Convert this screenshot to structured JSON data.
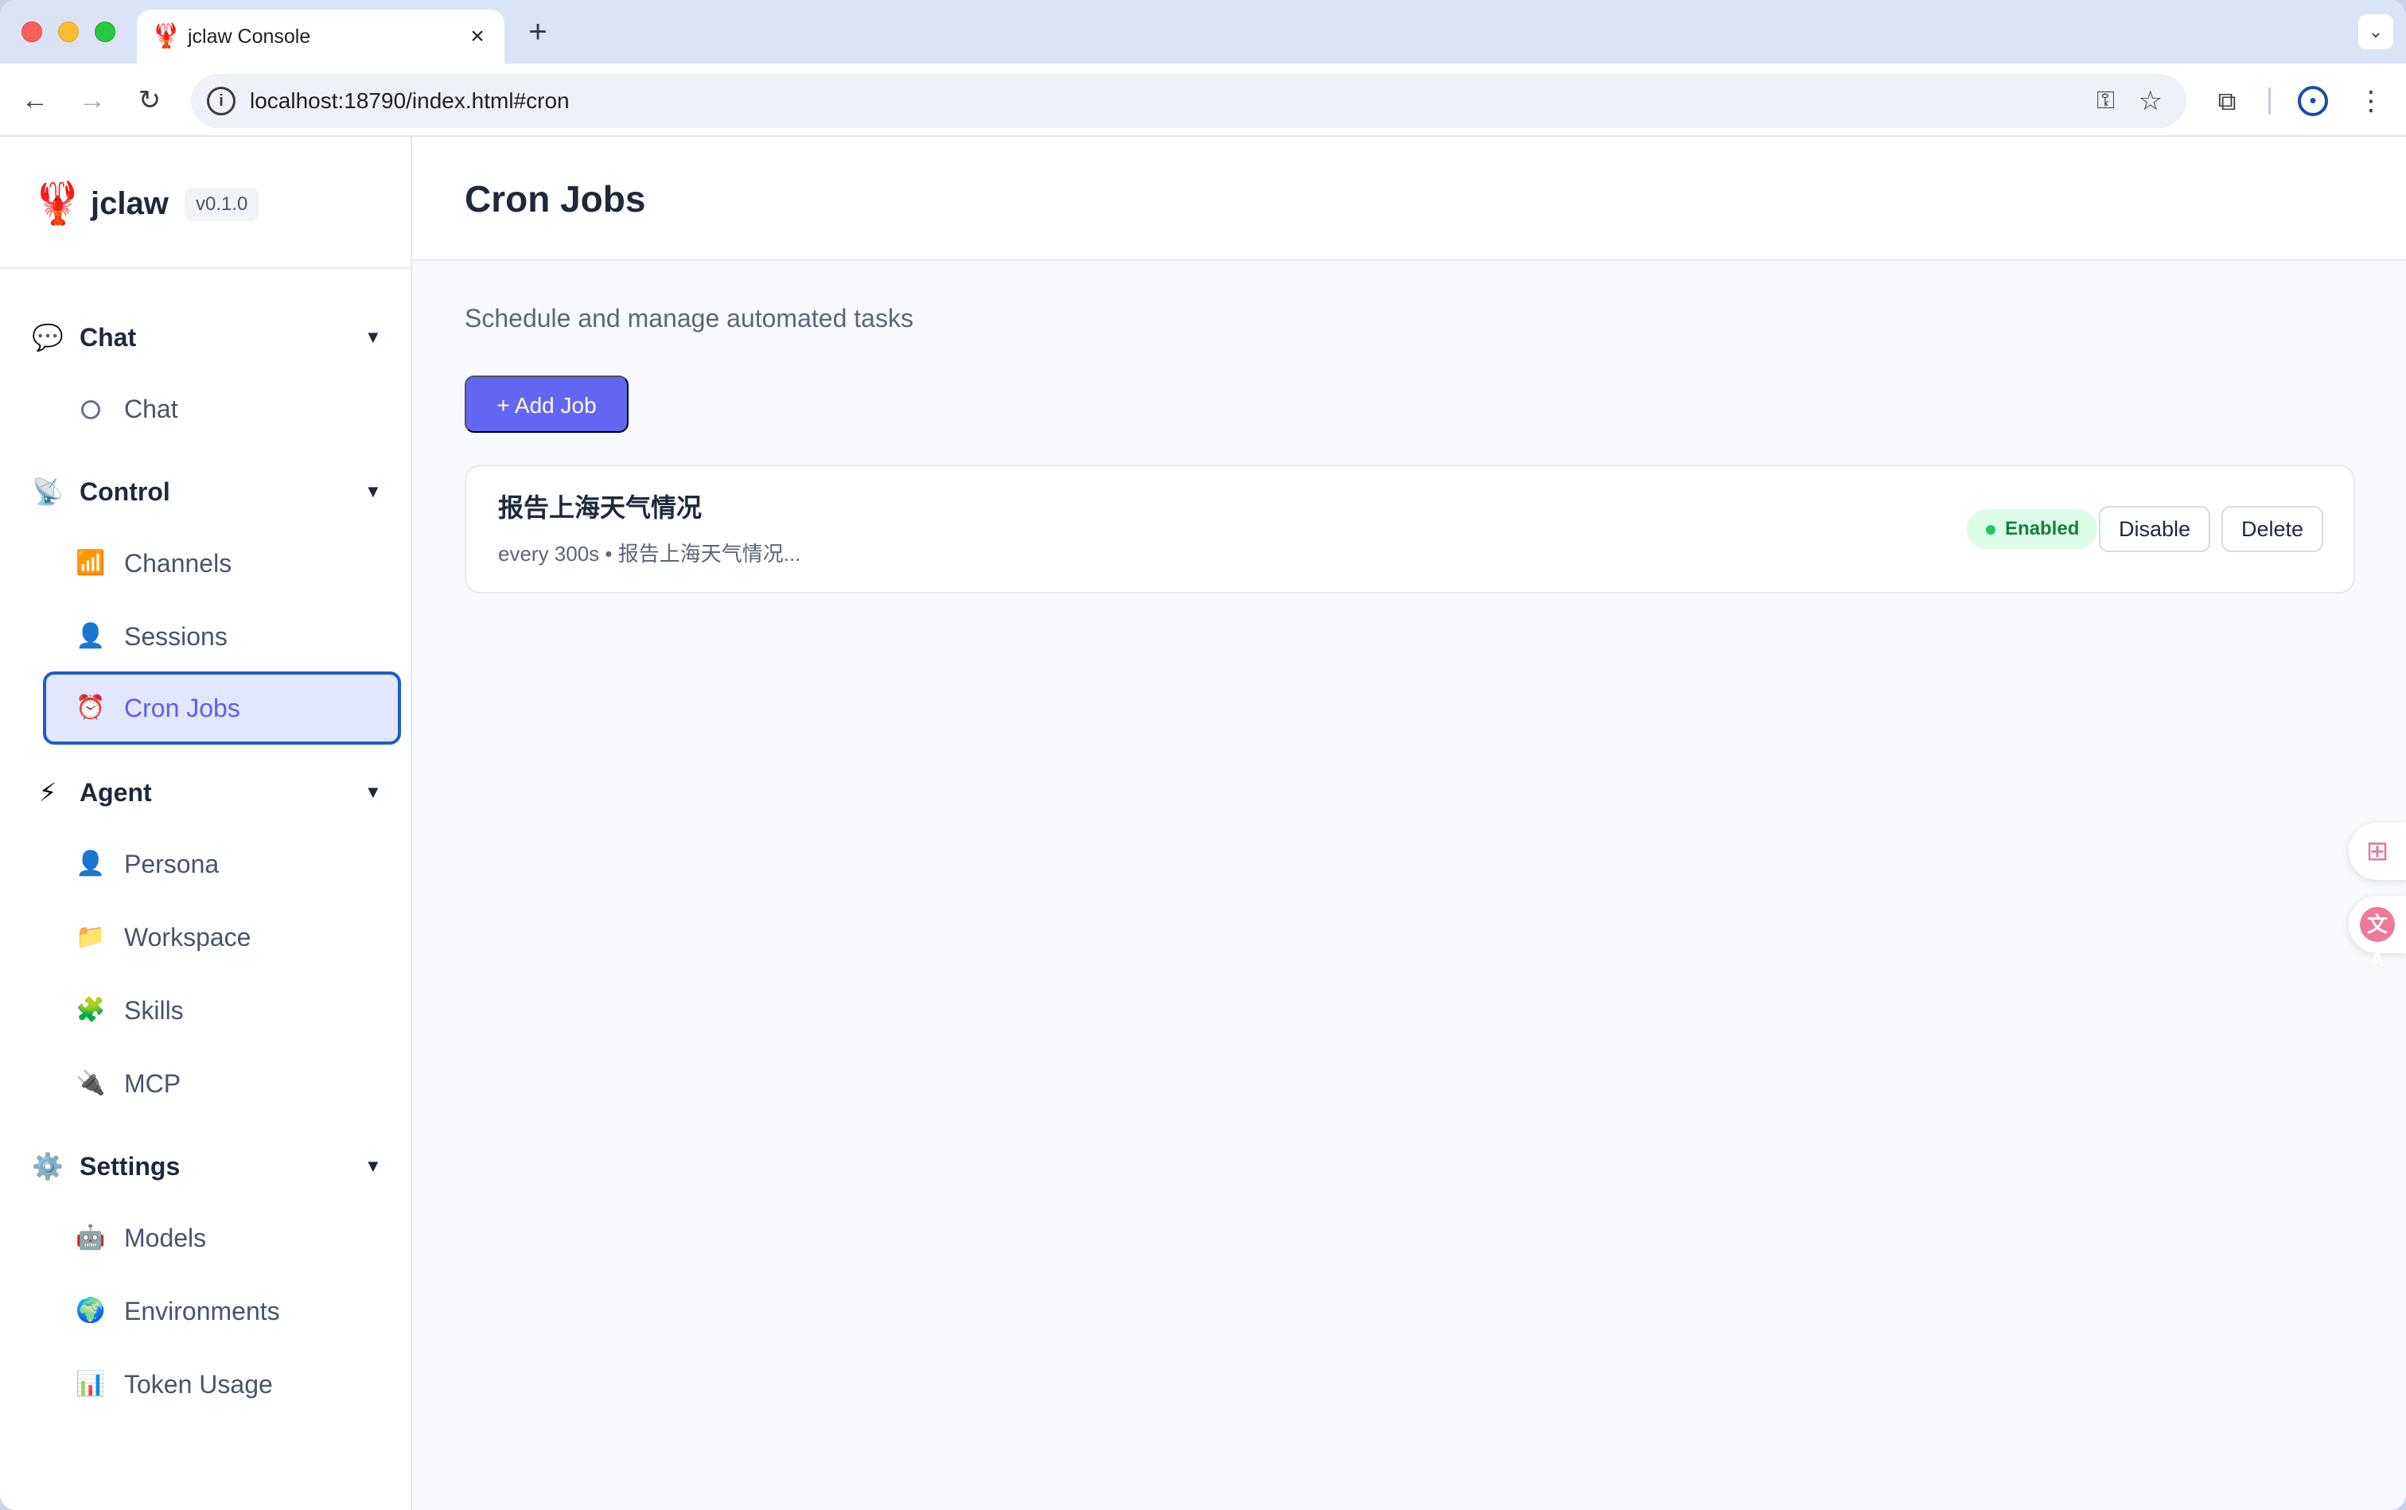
{
  "browser": {
    "tab_title": "jclaw Console",
    "tab_favicon": "🦞",
    "new_tab_label": "+",
    "url": "localhost:18790/index.html#cron"
  },
  "brand": {
    "logo": "🦞",
    "name": "jclaw",
    "version": "v0.1.0"
  },
  "sidebar": {
    "groups": [
      {
        "label": "Chat",
        "icon": "💬",
        "items": [
          {
            "label": "Chat",
            "icon": "ring-icon"
          }
        ]
      },
      {
        "label": "Control",
        "icon": "📡",
        "items": [
          {
            "label": "Channels",
            "icon": "📶"
          },
          {
            "label": "Sessions",
            "icon": "👤"
          },
          {
            "label": "Cron Jobs",
            "icon": "⏰",
            "active": true
          }
        ]
      },
      {
        "label": "Agent",
        "icon": "⚡",
        "items": [
          {
            "label": "Persona",
            "icon": "👤"
          },
          {
            "label": "Workspace",
            "icon": "📁"
          },
          {
            "label": "Skills",
            "icon": "🧩"
          },
          {
            "label": "MCP",
            "icon": "🔌"
          }
        ]
      },
      {
        "label": "Settings",
        "icon": "⚙️",
        "items": [
          {
            "label": "Models",
            "icon": "🤖"
          },
          {
            "label": "Environments",
            "icon": "🌍"
          },
          {
            "label": "Token Usage",
            "icon": "📊"
          }
        ]
      }
    ]
  },
  "main": {
    "title": "Cron Jobs",
    "subtitle": "Schedule and manage automated tasks",
    "add_button": "+ Add Job",
    "jobs": [
      {
        "title": "报告上海天气情况",
        "meta": "every 300s • 报告上海天气情况...",
        "status": "Enabled",
        "disable_label": "Disable",
        "delete_label": "Delete"
      }
    ]
  },
  "colors": {
    "accent": "#6366f1",
    "active_border": "#1a5fd0",
    "enabled_bg": "#dcfce7",
    "enabled_text": "#15803d"
  }
}
